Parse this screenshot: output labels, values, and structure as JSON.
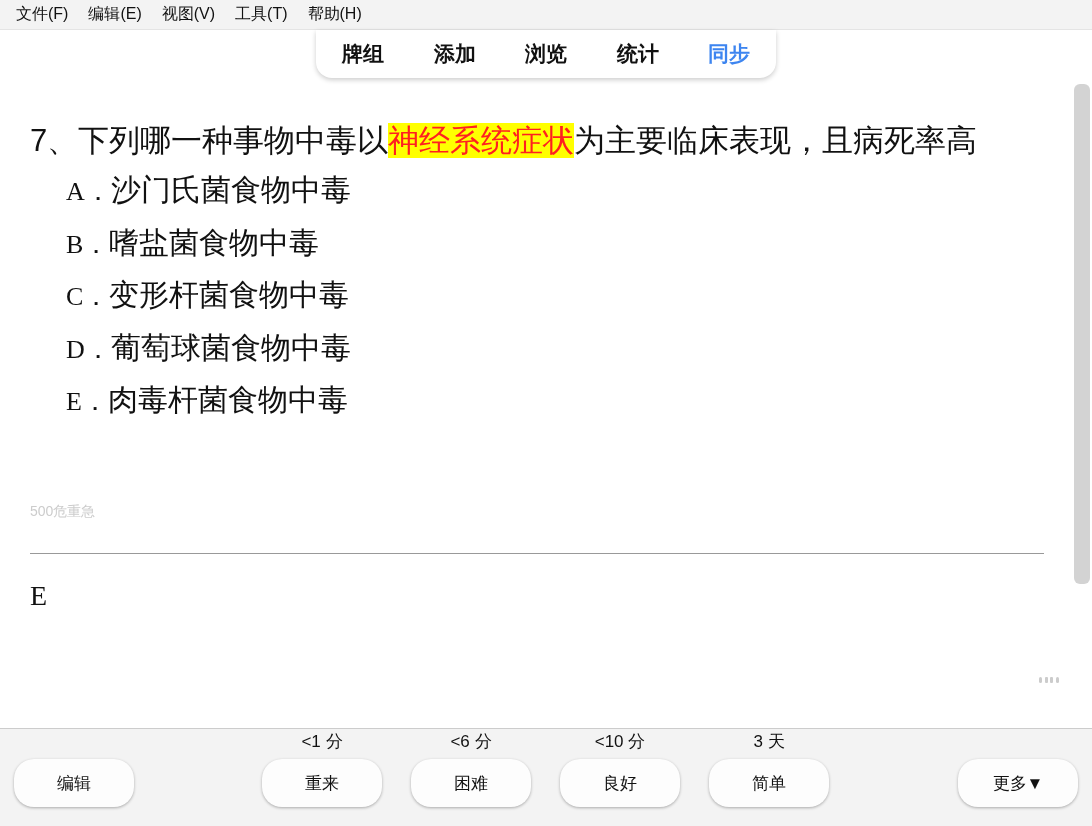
{
  "menu": [
    "文件(F)",
    "编辑(E)",
    "视图(V)",
    "工具(T)",
    "帮助(H)"
  ],
  "tabs": [
    {
      "label": "牌组",
      "selected": false
    },
    {
      "label": "添加",
      "selected": false
    },
    {
      "label": "浏览",
      "selected": false
    },
    {
      "label": "统计",
      "selected": false
    },
    {
      "label": "同步",
      "selected": true
    }
  ],
  "question": {
    "segments": [
      {
        "text": "7、下列哪一种事物中毒以",
        "highlighted": false
      },
      {
        "text": "神经系统症状",
        "highlighted": true
      },
      {
        "text": "为主要临床表现，且病死率高",
        "highlighted": false
      }
    ],
    "options": [
      {
        "letter": "A．",
        "text": "沙门氏菌食物中毒"
      },
      {
        "letter": "B．",
        "text": "嗜盐菌食物中毒"
      },
      {
        "letter": "C．",
        "text": "变形杆菌食物中毒"
      },
      {
        "letter": "D．",
        "text": "葡萄球菌食物中毒"
      },
      {
        "letter": "E．",
        "text": "肉毒杆菌食物中毒"
      }
    ],
    "source": "500危重急"
  },
  "answer": "E",
  "bottom": {
    "edit": "编辑",
    "answers": [
      {
        "interval": "<1 分",
        "label": "重来"
      },
      {
        "interval": "<6 分",
        "label": "困难"
      },
      {
        "interval": "<10 分",
        "label": "良好"
      },
      {
        "interval": "3 天",
        "label": "简单"
      }
    ],
    "more": "更多▼"
  }
}
